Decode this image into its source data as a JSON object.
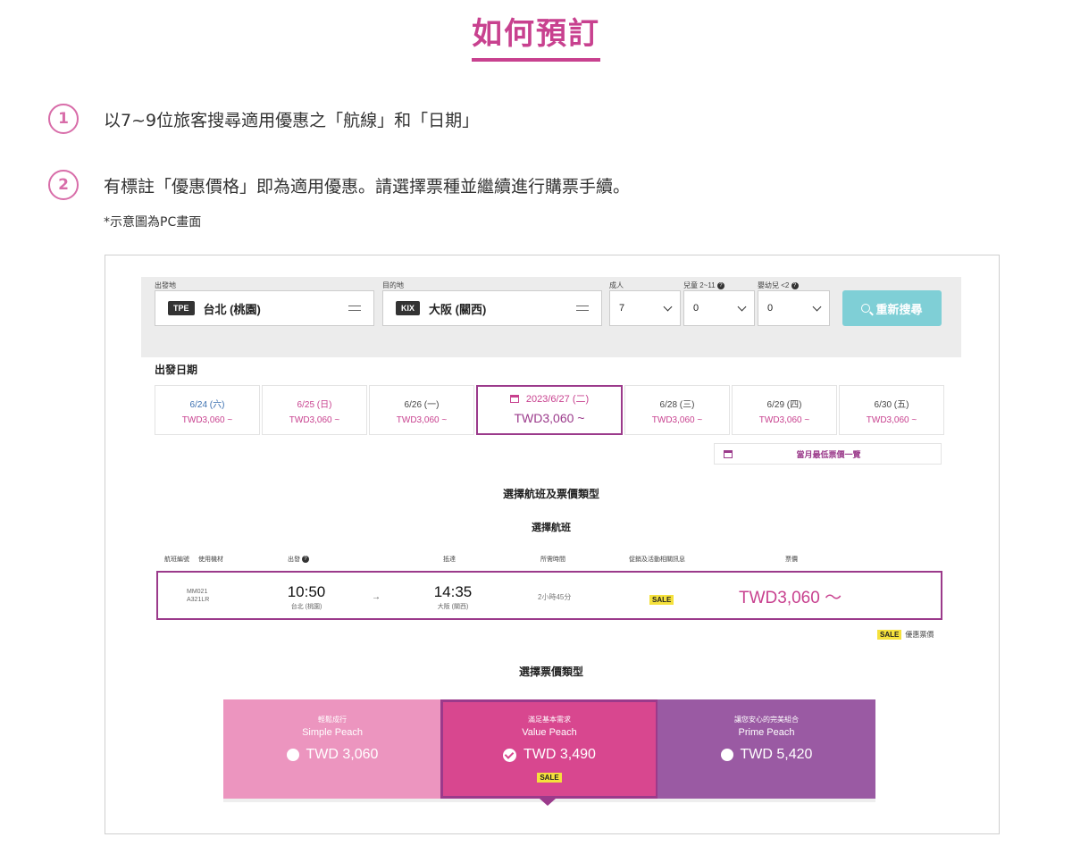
{
  "title": "如何預訂",
  "steps": [
    {
      "num": "1",
      "text": "以7~9位旅客搜尋適用優惠之「航線」和「日期」"
    },
    {
      "num": "2",
      "text": "有標註「優惠價格」即為適用優惠。請選擇票種並繼續進行購票手續。"
    }
  ],
  "note": "*示意圖為PC畫面",
  "search": {
    "origin_label": "出發地",
    "origin_code": "TPE",
    "origin_name": "台北 (桃園)",
    "dest_label": "目的地",
    "dest_code": "KIX",
    "dest_name": "大阪 (關西)",
    "adult_label": "成人",
    "adult_value": "7",
    "child_label": "兒童 2~11",
    "child_value": "0",
    "infant_label": "嬰幼兒 <2",
    "infant_value": "0",
    "search_button": "重新搜尋"
  },
  "departure_label": "出發日期",
  "dates": [
    {
      "date": "6/24 (六)",
      "price": "TWD3,060 ~"
    },
    {
      "date": "6/25 (日)",
      "price": "TWD3,060 ~"
    },
    {
      "date": "6/26 (一)",
      "price": "TWD3,060 ~"
    },
    {
      "date": "2023/6/27 (二)",
      "price": "TWD3,060 ~"
    },
    {
      "date": "6/28 (三)",
      "price": "TWD3,060 ~"
    },
    {
      "date": "6/29 (四)",
      "price": "TWD3,060 ~"
    },
    {
      "date": "6/30 (五)",
      "price": "TWD3,060 ~"
    }
  ],
  "monthly_button": "當月最低票價一覽",
  "select_flight_fare": "選擇航班及票價類型",
  "select_flight": "選擇航班",
  "columns": {
    "flight_no": "航班編號",
    "aircraft": "使用機材",
    "depart": "出發",
    "arrive": "抵達",
    "duration": "所需時間",
    "promo": "促銷及活動相關訊息",
    "fare": "票價"
  },
  "flight": {
    "number": "MM021",
    "aircraft": "A321LR",
    "dep_time": "10:50",
    "dep_city": "台北 (桃園)",
    "arrow": "→",
    "arr_time": "14:35",
    "arr_city": "大阪 (關西)",
    "duration": "2小時45分",
    "sale": "SALE",
    "price": "TWD3,060 ～"
  },
  "legend": {
    "badge": "SALE",
    "text": "優惠票價"
  },
  "select_fare_type": "選擇票價類型",
  "fares": [
    {
      "tagline": "輕鬆成行",
      "name": "Simple Peach",
      "price": "TWD 3,060"
    },
    {
      "tagline": "滿足基本需求",
      "name": "Value Peach",
      "price": "TWD 3,490",
      "badge": "SALE"
    },
    {
      "tagline": "讓您安心的完美組合",
      "name": "Prime Peach",
      "price": "TWD 5,420"
    }
  ],
  "colors": {
    "brand_pink": "#c8418f",
    "brand_purple": "#9b3a8b",
    "search_button": "#7fcfd6",
    "sale_yellow": "#f5e13c",
    "simple": "#ec95bf",
    "value": "#d8478f",
    "prime": "#9a5aa3"
  }
}
